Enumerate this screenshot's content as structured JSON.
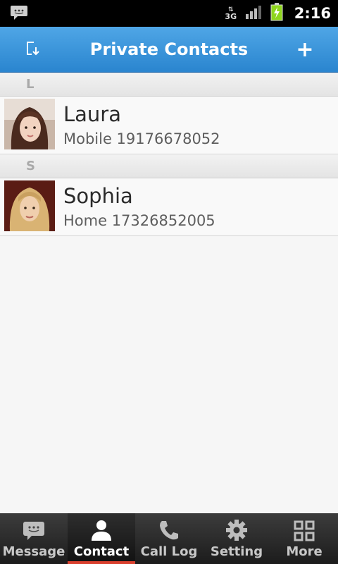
{
  "status_bar": {
    "network": "3G",
    "time": "2:16",
    "colors": {
      "battery": "#8ed51c"
    }
  },
  "title_bar": {
    "title": "Private Contacts",
    "left_icon": "import-icon",
    "right_icon": "plus-icon",
    "right_label": "+",
    "colors": {
      "top": "#4fa6e6",
      "bottom": "#2a85cf"
    }
  },
  "contacts": [
    {
      "section": "L",
      "name": "Laura",
      "detail": "Mobile 19176678052",
      "avatar": "portrait-photo"
    },
    {
      "section": "S",
      "name": "Sophia",
      "detail": "Home 17326852005",
      "avatar": "portrait-photo"
    }
  ],
  "bottom_nav": {
    "items": [
      {
        "label": "Message",
        "icon": "message-icon",
        "active": false
      },
      {
        "label": "Contact",
        "icon": "contact-icon",
        "active": true
      },
      {
        "label": "Call Log",
        "icon": "phone-icon",
        "active": false
      },
      {
        "label": "Setting",
        "icon": "gear-icon",
        "active": false
      },
      {
        "label": "More",
        "icon": "grid-icon",
        "active": false
      }
    ],
    "colors": {
      "active_underline": "#d9402e"
    }
  }
}
